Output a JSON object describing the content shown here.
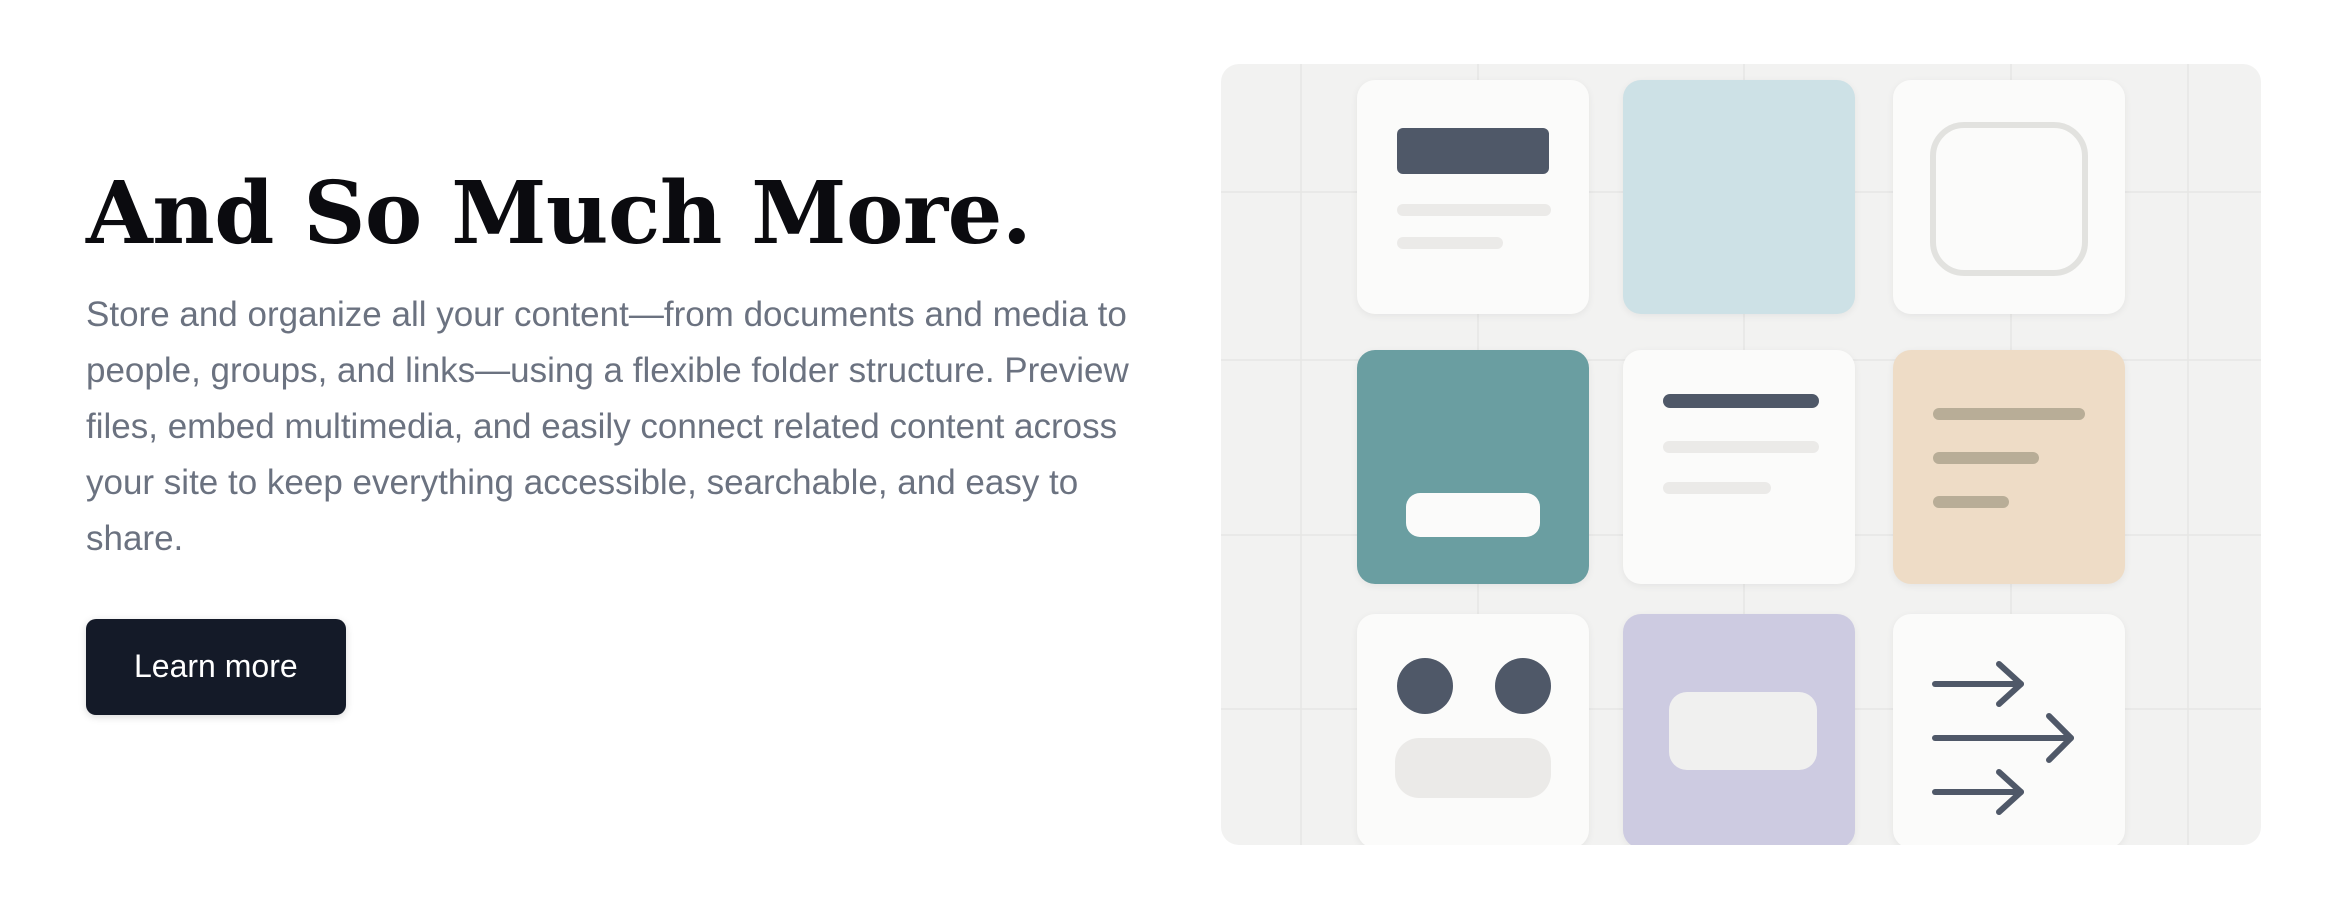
{
  "hero": {
    "headline": "And So Much More.",
    "body": "Store and organize all your content—from documents and media to people, groups, and links—using a flexible folder structure. Preview files, embed multimedia, and easily connect related content across your site to keep everything accessible, searchable, and easy to share.",
    "cta_label": "Learn more"
  },
  "illustration": {
    "panel_color": "#f2f2f1",
    "tile_colors": {
      "white": "#fbfbfa",
      "light_blue": "#cde1e6",
      "teal": "#6a9ea1",
      "peach": "#eedcc6",
      "lavender": "#cdcbe1"
    },
    "accent_dark": "#4f5868",
    "icons": [
      "document-card-icon",
      "blank-card-icon",
      "rounded-square-icon",
      "media-card-icon",
      "text-lines-icon",
      "notes-icon",
      "people-icon",
      "folder-card-icon",
      "arrows-icon"
    ]
  }
}
